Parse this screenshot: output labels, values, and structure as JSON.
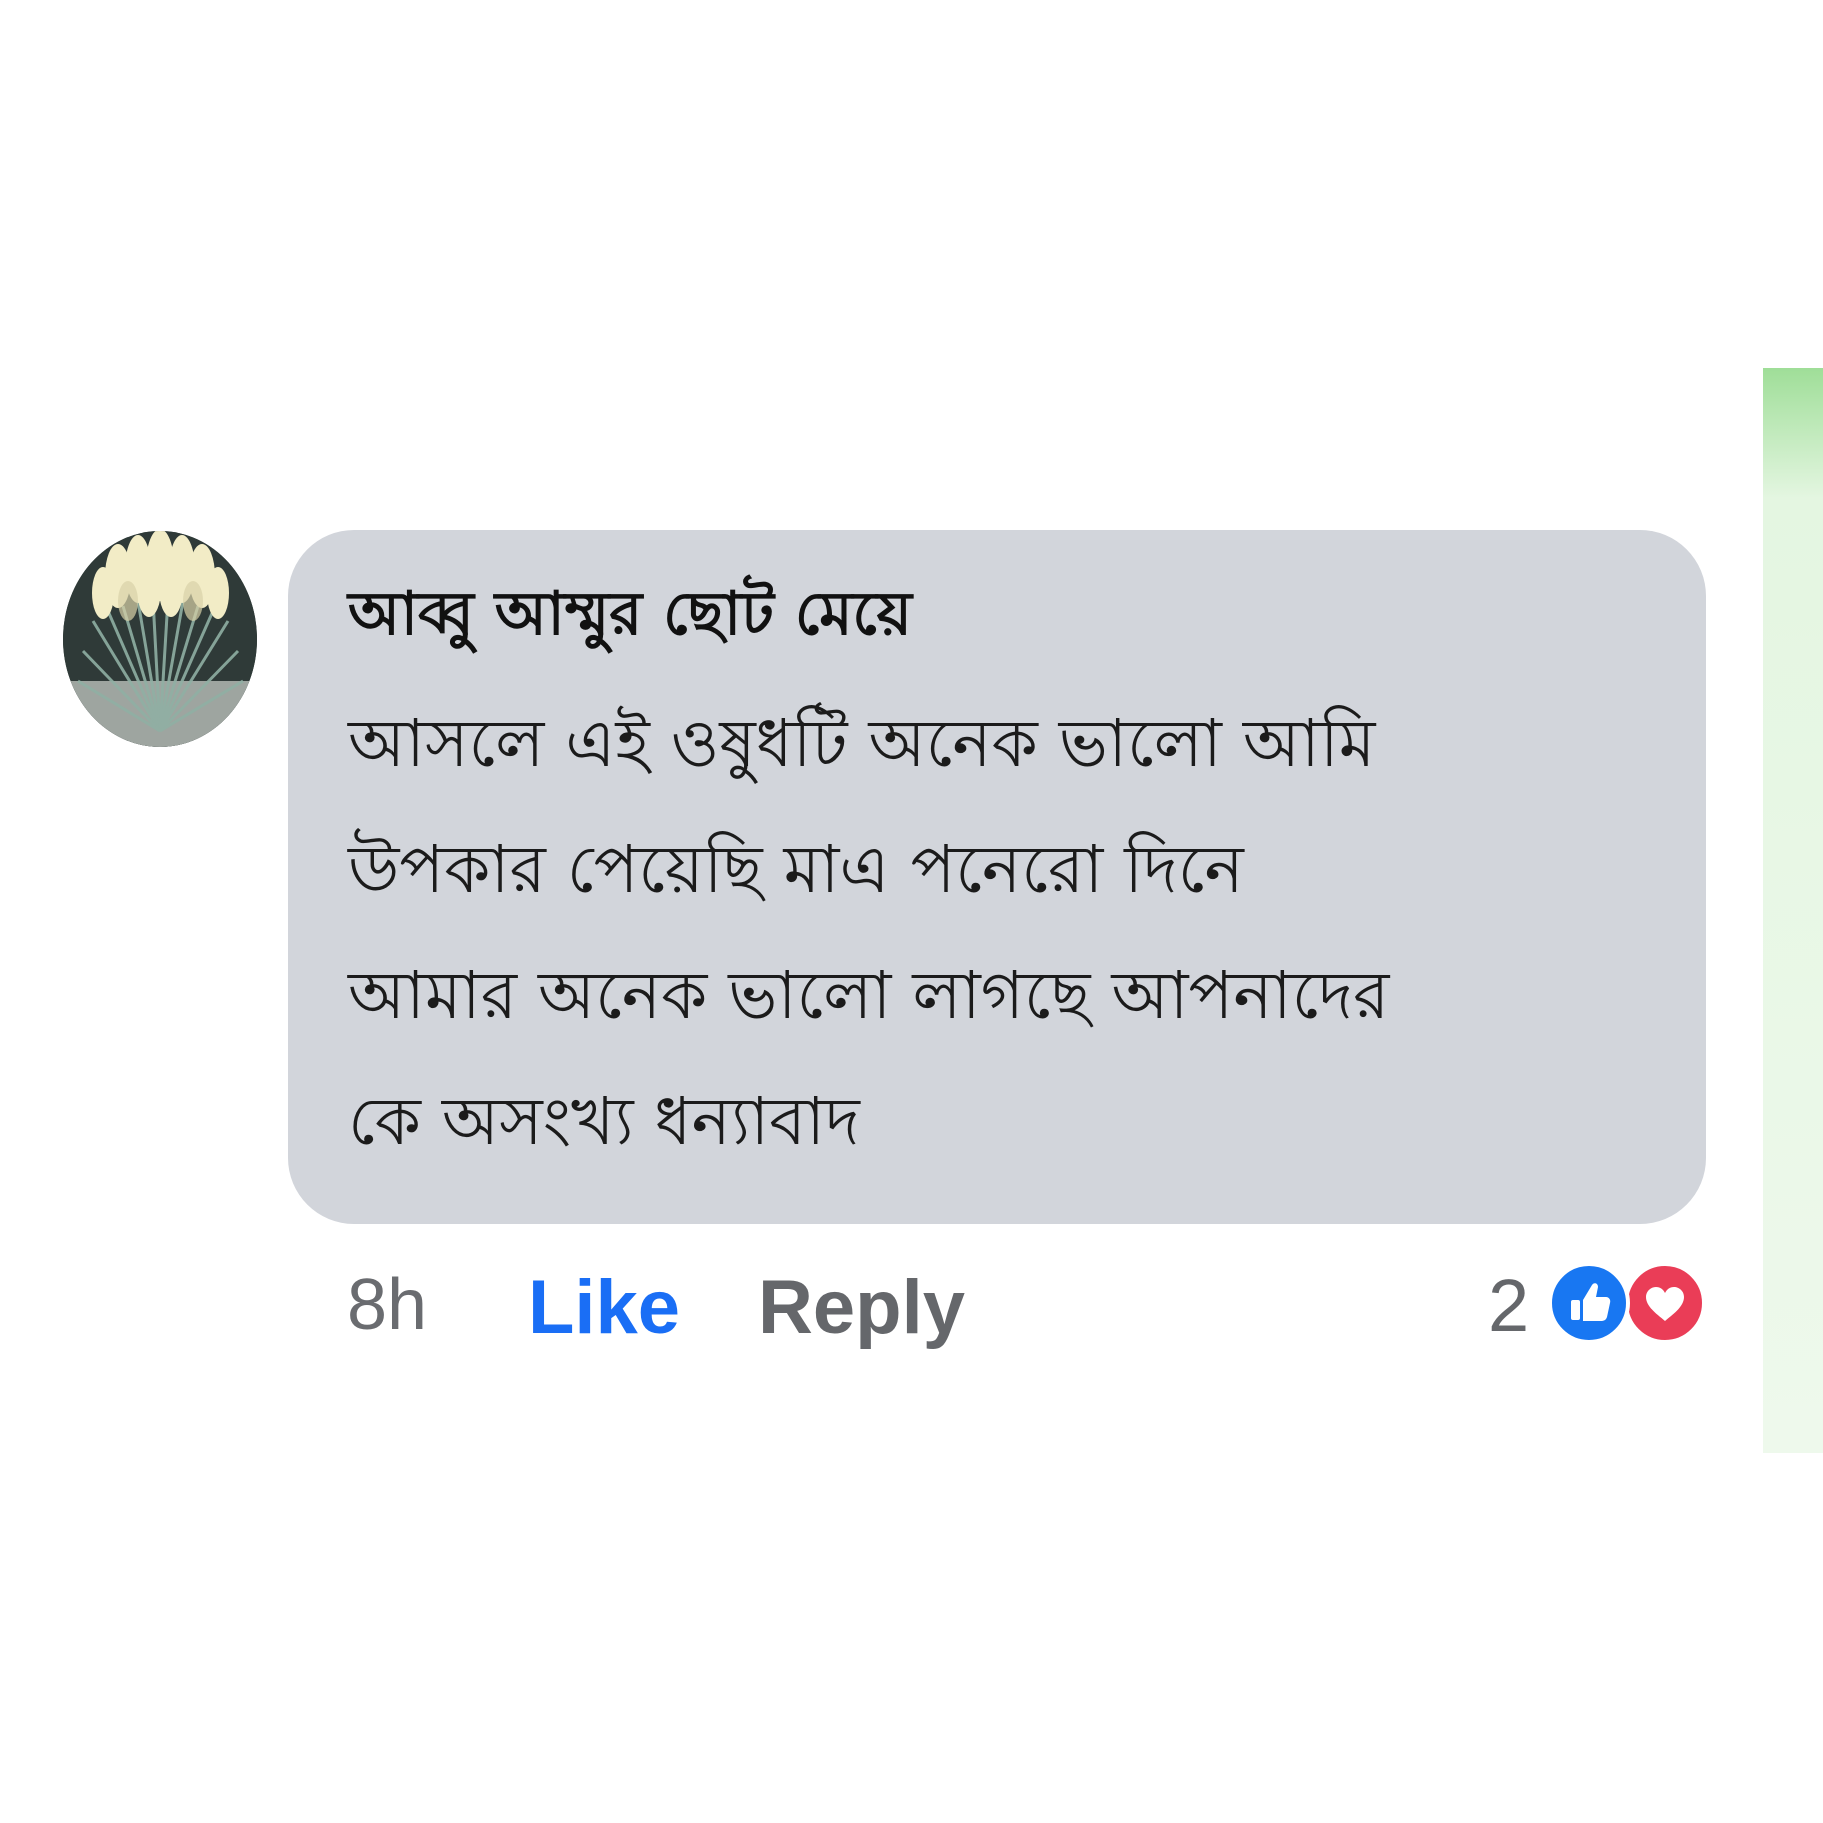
{
  "comment": {
    "author": "আব্বু আম্মুর ছোট মেয়ে",
    "lines": [
      "আসলে এই ওষুধটি অনেক ভালো আমি",
      "উপকার পেয়েছি মাএ পনেরো দিনে",
      "আমার অনেক ভালো লাগছে আপনাদের",
      "কে অসংখ্য ধন্যাবাদ"
    ],
    "time": "8h",
    "like_label": "Like",
    "reply_label": "Reply",
    "reaction_count": "2",
    "reactions": [
      "like-icon",
      "love-icon"
    ]
  },
  "colors": {
    "bubble": "#d2d5db",
    "like_link": "#1a6ef5",
    "meta_text": "#65676b",
    "reaction_like": "#1877f2",
    "reaction_love": "#ea3d57"
  }
}
